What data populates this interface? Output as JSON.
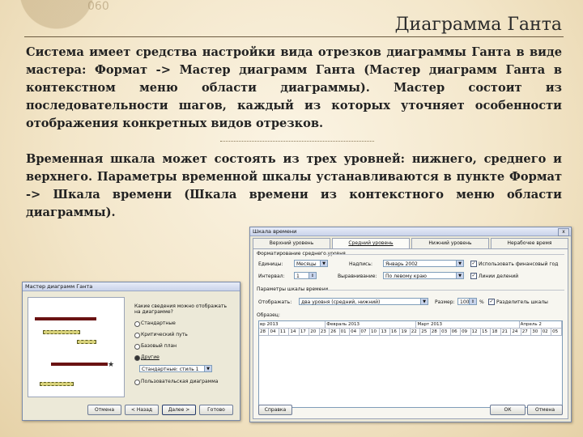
{
  "slide": {
    "title": "Диаграмма Ганта",
    "deco_number": "060",
    "paragraph1": "Система имеет средства настройки вида отрезков диаграммы Ганта в виде мастера: Формат -> Мастер диаграмм Ганта (Мастер диаграмм Ганта в контекстном меню области диаграммы). Мастер состоит из последовательности шагов, каждый из которых уточняет особенности отображения конкретных видов отрезков.",
    "paragraph2": "Временная шкала может состоять из трех уровней: нижнего, среднего и верхнего. Параметры временной шкалы устанавливаются в пункте Формат -> Шкала времени (Шкала времени из контекстного меню области диаграммы)."
  },
  "timescale_dialog": {
    "title": "Шкала времени",
    "close": "x",
    "tabs": [
      "Верхний уровень",
      "Средний уровень",
      "Нижний уровень",
      "Нерабочее время"
    ],
    "group_format": "Форматирование среднего уровня",
    "units_label": "Единицы:",
    "units_value": "Месяцы",
    "label_label": "Надпись:",
    "label_value": "Январь 2002",
    "fiscal_checkbox": "Использовать финансовый год",
    "count_label": "Интервал:",
    "count_value": "1",
    "align_label": "Выравнивание:",
    "align_value": "По левому краю",
    "ticks_checkbox": "Линии делений",
    "group_options": "Параметры шкалы времени",
    "show_label": "Отображать:",
    "show_value": "два уровня (средний, нижний)",
    "size_label": "Размер:",
    "size_value": "100",
    "percent": "%",
    "separator_checkbox": "Разделитель шкалы",
    "preview_label": "Образец:",
    "months": [
      "вр 2013",
      "Февраль 2013",
      "Март 2013",
      "Апрель 2"
    ],
    "days": [
      "28",
      "04",
      "11",
      "14",
      "17",
      "20",
      "23",
      "26",
      "01",
      "04",
      "07",
      "10",
      "13",
      "16",
      "19",
      "22",
      "25",
      "28",
      "03",
      "06",
      "09",
      "12",
      "15",
      "18",
      "21",
      "24",
      "27",
      "30",
      "02",
      "05"
    ],
    "ok": "Справка",
    "ok_btn": "ОК",
    "cancel_btn": "Отмена"
  },
  "wizard_dialog": {
    "title": "Мастер диаграмм Ганта",
    "question": "Какие сведения можно отображать на диаграмме?",
    "options": [
      "Стандартные",
      "Критический путь",
      "Базовый план",
      "Другие",
      "Пользовательская диаграмма"
    ],
    "select_value": "Стандартные: стиль 1",
    "buttons": [
      "Отмена",
      "< Назад",
      "Далее >",
      "Готово"
    ]
  },
  "colors": {
    "accent": "#8b1a1a",
    "bar": "#b8b040"
  }
}
